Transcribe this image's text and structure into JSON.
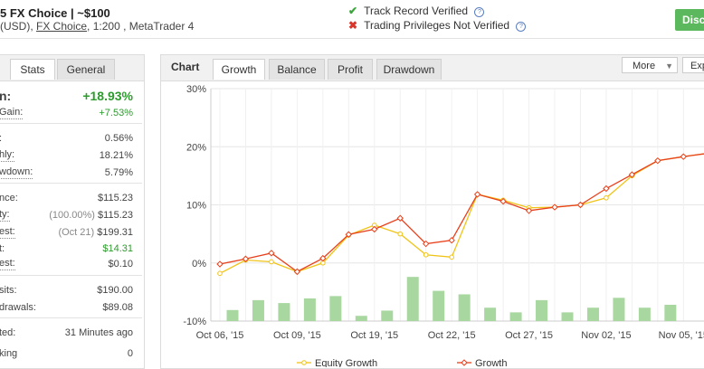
{
  "header": {
    "title": "5 FX Choice | ~$100",
    "sub_prefix": "(USD),",
    "sub_link": "FX Choice",
    "sub_suffix": ", 1:200 , MetaTrader 4",
    "verified": {
      "icon": "check-icon",
      "text": "Track Record Verified",
      "color": "#3aa63a"
    },
    "not_verified": {
      "icon": "cross-icon",
      "text": "Trading Privileges Not Verified",
      "color": "#d9362b"
    },
    "discuss_label": "Disc"
  },
  "left_panel": {
    "tabs": [
      "Stats",
      "General"
    ],
    "rows": [
      {
        "label": "n:",
        "value": "+18.93%"
      },
      {
        "label": "Gain:",
        "value": "+7.53%"
      },
      {
        "label": ":",
        "value": "0.56%"
      },
      {
        "label": "hly:",
        "value": "18.21%"
      },
      {
        "label": "wdown:",
        "value": "5.79%"
      },
      {
        "label": "nce:",
        "value": "$115.23"
      },
      {
        "label": "ty:",
        "pre": "(100.00%)",
        "value": "$115.23"
      },
      {
        "label": "est:",
        "pre": "(Oct 21)",
        "value": "$199.31"
      },
      {
        "label": "t:",
        "value": "$14.31"
      },
      {
        "label": "est:",
        "value": "$0.10"
      },
      {
        "label": "sits:",
        "value": "$190.00"
      },
      {
        "label": "drawals:",
        "value": "$89.08"
      },
      {
        "label": "ted:",
        "value": "31 Minutes ago"
      },
      {
        "label": "king",
        "value": "0"
      }
    ]
  },
  "chart_panel": {
    "label": "Chart",
    "tabs": [
      "Growth",
      "Balance",
      "Profit",
      "Drawdown"
    ],
    "more_label": "More",
    "export_label": "Exp"
  },
  "chart_data": {
    "type": "line",
    "x": [
      0,
      1,
      2,
      3,
      4,
      5,
      6,
      7,
      8,
      9,
      10,
      11,
      12,
      13,
      14,
      15,
      16,
      17,
      18,
      19
    ],
    "x_tick_labels": [
      "Oct 06, '15",
      "Oct 09, '15",
      "Oct 19, '15",
      "Oct 22, '15",
      "Oct 27, '15",
      "Nov 02, '15",
      "Nov 05, '15"
    ],
    "x_tick_positions": [
      0,
      3,
      6,
      9,
      12,
      15,
      18
    ],
    "ylim": [
      -10,
      30
    ],
    "y_ticks": [
      -10,
      0,
      10,
      20,
      30
    ],
    "y_tick_labels": [
      "-10%",
      "0%",
      "10%",
      "20%",
      "30%"
    ],
    "series": [
      {
        "name": "Equity Growth",
        "color": "#f0c419",
        "values": [
          -1.8,
          0.5,
          0.2,
          -1.5,
          0,
          4.8,
          6.5,
          5,
          1.4,
          1,
          11.8,
          10.8,
          9.5,
          9.6,
          10,
          11.2,
          15,
          17.6,
          18.3,
          18.9
        ]
      },
      {
        "name": "Growth",
        "color": "#e8401c",
        "values": [
          -0.2,
          0.7,
          1.7,
          -1.5,
          0.8,
          4.9,
          5.8,
          7.7,
          3.3,
          3.9,
          11.8,
          10.6,
          9,
          9.6,
          10,
          12.8,
          15.2,
          17.6,
          18.3,
          18.9
        ]
      }
    ],
    "bars": {
      "color": "#a8d8a0",
      "values": [
        1.9,
        3.6,
        3.1,
        3.9,
        4.3,
        0.9,
        1.8,
        7.6,
        5.2,
        4.6,
        2.3,
        1.5,
        3.6,
        1.5,
        2.3,
        4,
        2.3,
        2.8,
        0,
        0
      ]
    },
    "legend_position": "bottom"
  }
}
